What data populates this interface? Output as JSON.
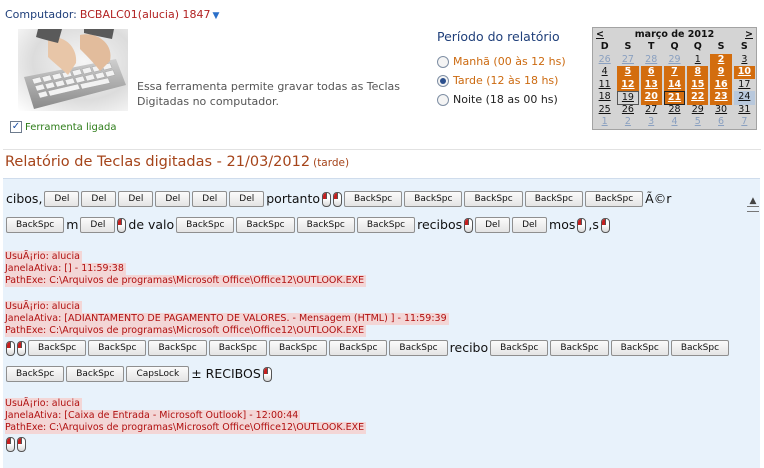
{
  "computer": {
    "label": "Computador:",
    "value": "BCBALC01(alucia) 1847"
  },
  "tool": {
    "description": "Essa ferramenta permite gravar todas as Teclas Digitadas no computador.",
    "toggle_label": "Ferramenta ligada",
    "enabled": true
  },
  "period": {
    "title": "Período do relatório",
    "options": [
      {
        "label": "Manhã (00 às 12 hs)",
        "selected": false
      },
      {
        "label": "Tarde (12 às 18 hs)",
        "selected": true
      },
      {
        "label": "Noite (18 as 00 hs)",
        "selected": false
      }
    ]
  },
  "calendar": {
    "prev": "<",
    "month": "março de 2012",
    "next": ">",
    "weekdays": [
      "D",
      "S",
      "T",
      "Q",
      "Q",
      "S",
      "S"
    ],
    "weeks": [
      [
        "26",
        "27",
        "28",
        "29",
        "1",
        "2",
        "3"
      ],
      [
        "4",
        "5",
        "6",
        "7",
        "8",
        "9",
        "10"
      ],
      [
        "11",
        "12",
        "13",
        "14",
        "15",
        "16",
        "17"
      ],
      [
        "18",
        "19",
        "20",
        "21",
        "22",
        "23",
        "24"
      ],
      [
        "25",
        "26",
        "27",
        "28",
        "29",
        "30",
        "31"
      ],
      [
        "1",
        "2",
        "3",
        "4",
        "5",
        "6",
        "7"
      ]
    ]
  },
  "report": {
    "title": "Relatório de Teclas digitadas - 21/03/2012",
    "period_note": "(tarde)"
  },
  "keys": {
    "del": "Del",
    "backspace": "BackSpc",
    "capslock": "CapsLock"
  },
  "text": {
    "t1": "cibos,",
    "t2": "portanto",
    "t3": "Ã©r",
    "t4": "m",
    "t5": "de valo",
    "t6": "recibos",
    "t7": "mos",
    "t8": ",s",
    "t9": "recibo",
    "t10": "± RECIBOS"
  },
  "entries": [
    {
      "user": "UsuÃ¡rio: alucia",
      "window": "JanelaAtiva: [] - 11:59:38",
      "path": "PathExe: C:\\Arquivos de programas\\Microsoft Office\\Office12\\OUTLOOK.EXE"
    },
    {
      "user": "UsuÃ¡rio: alucia",
      "window": "JanelaAtiva: [ADIANTAMENTO DE PAGAMENTO DE VALORES. - Mensagem (HTML) ] - 11:59:39",
      "path": "PathExe: C:\\Arquivos de programas\\Microsoft Office\\Office12\\OUTLOOK.EXE"
    },
    {
      "user": "UsuÃ¡rio: alucia",
      "window": "JanelaAtiva: [Caixa de Entrada - Microsoft Outlook] - 12:00:44",
      "path": "PathExe: C:\\Arquivos de programas\\Microsoft Office\\Office12\\OUTLOOK.EXE"
    }
  ],
  "colors": {
    "accent_orange": "#d36d0e",
    "title_brown": "#a5441a",
    "panel_bg": "#e8f2fb",
    "info_red": "#b01010"
  }
}
